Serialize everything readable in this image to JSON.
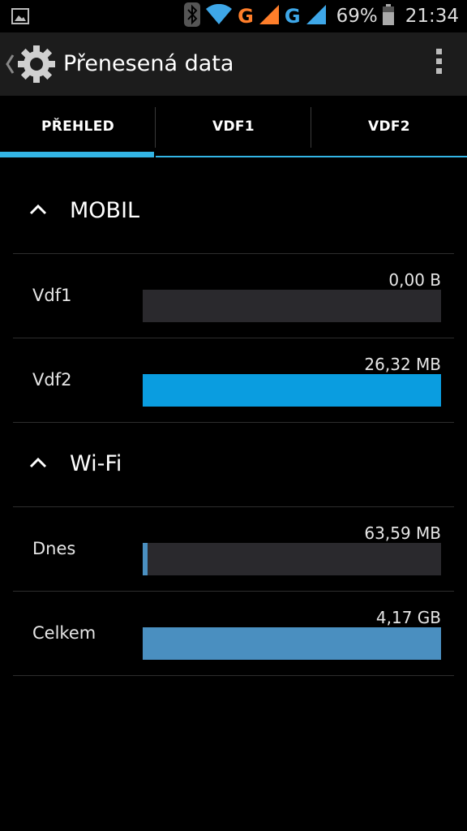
{
  "status_bar": {
    "network1": "G",
    "network2": "G",
    "battery": "69%",
    "time": "21:34",
    "colors": {
      "network1": "#ff7e2a",
      "network2": "#3ea7e8"
    }
  },
  "action_bar": {
    "title": "Přenesená data"
  },
  "tabs": [
    {
      "label": "PŘEHLED",
      "active": true
    },
    {
      "label": "VDF1",
      "active": false
    },
    {
      "label": "VDF2",
      "active": false
    }
  ],
  "sections": {
    "mobile": {
      "title": "MOBIL",
      "rows": [
        {
          "label": "Vdf1",
          "value": "0,00 B",
          "fill": 0.0,
          "color": "#0a9de0"
        },
        {
          "label": "Vdf2",
          "value": "26,32 MB",
          "fill": 1.0,
          "color": "#0a9de0"
        }
      ]
    },
    "wifi": {
      "title": "Wi-Fi",
      "rows": [
        {
          "label": "Dnes",
          "value": "63,59 MB",
          "fill": 0.015,
          "color": "#4a8fc0"
        },
        {
          "label": "Celkem",
          "value": "4,17 GB",
          "fill": 1.0,
          "color": "#4a8fc0"
        }
      ]
    }
  },
  "accent_color": "#33b5e5"
}
